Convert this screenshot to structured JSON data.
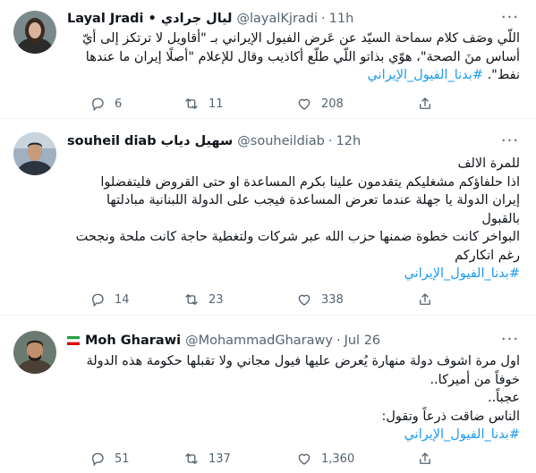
{
  "tweets": [
    {
      "name": "Layal Jradi • ليال جرادي",
      "handle": "@layalKjradi",
      "time": "11h",
      "lines": [
        "اللّي وصَف كلام سماحة السيّد عن عَرض الفيول الإيراني بـ \"أقاويل لا ترتكز إلى أيّ",
        "أساس منَ الصحة\"، هوّي بذاتو اللّي طلّع أكاذيب وقال للإعلام \"أصلًا إيران ما عندها",
        "نفط\". "
      ],
      "hashtag": "#بدنا_الفيول_الإيراني",
      "replies": "6",
      "retweets": "11",
      "likes": "208"
    },
    {
      "name": "souheil diab سهيل دياب",
      "handle": "@souheildiab",
      "time": "12h",
      "lines": [
        "للمرة الالف",
        "اذا حلفاؤكم مشغليكم يتقدمون علينا بكرم المساعدة او حتى القروض فليتفضلوا",
        "إيران الدولة يا جهلة عندما تعرض المساعدة فيجب على الدولة اللبنانية مبادلتها",
        "بالقبول",
        "البواخر كانت خطوة ضمنها حزب الله عبر شركات ولتغطية حاجة كانت ملحة ونجحت",
        "رغم انكاركم"
      ],
      "hashtag": "#بدنا_الفيول_الإيراني",
      "replies": "14",
      "retweets": "23",
      "likes": "338"
    },
    {
      "name": "Moh Gharawi",
      "handle": "@MohammadGharawy",
      "time": "Jul 26",
      "lines": [
        "اول مرة اشوف دولة منهارة يُعرض عليها فيول مجاني ولا تقبلها حكومة هذه الدولة",
        "خوفاً من أميركا..",
        "عجباً..",
        "الناس ضاقت ذرعاً وتقول:"
      ],
      "hashtag": "#بدنا_الفيول_الإيراني",
      "replies": "51",
      "retweets": "137",
      "likes": "1,360"
    }
  ],
  "colors": {
    "accent": "#1d9bf0",
    "muted": "#536471",
    "text": "#0f1419"
  }
}
